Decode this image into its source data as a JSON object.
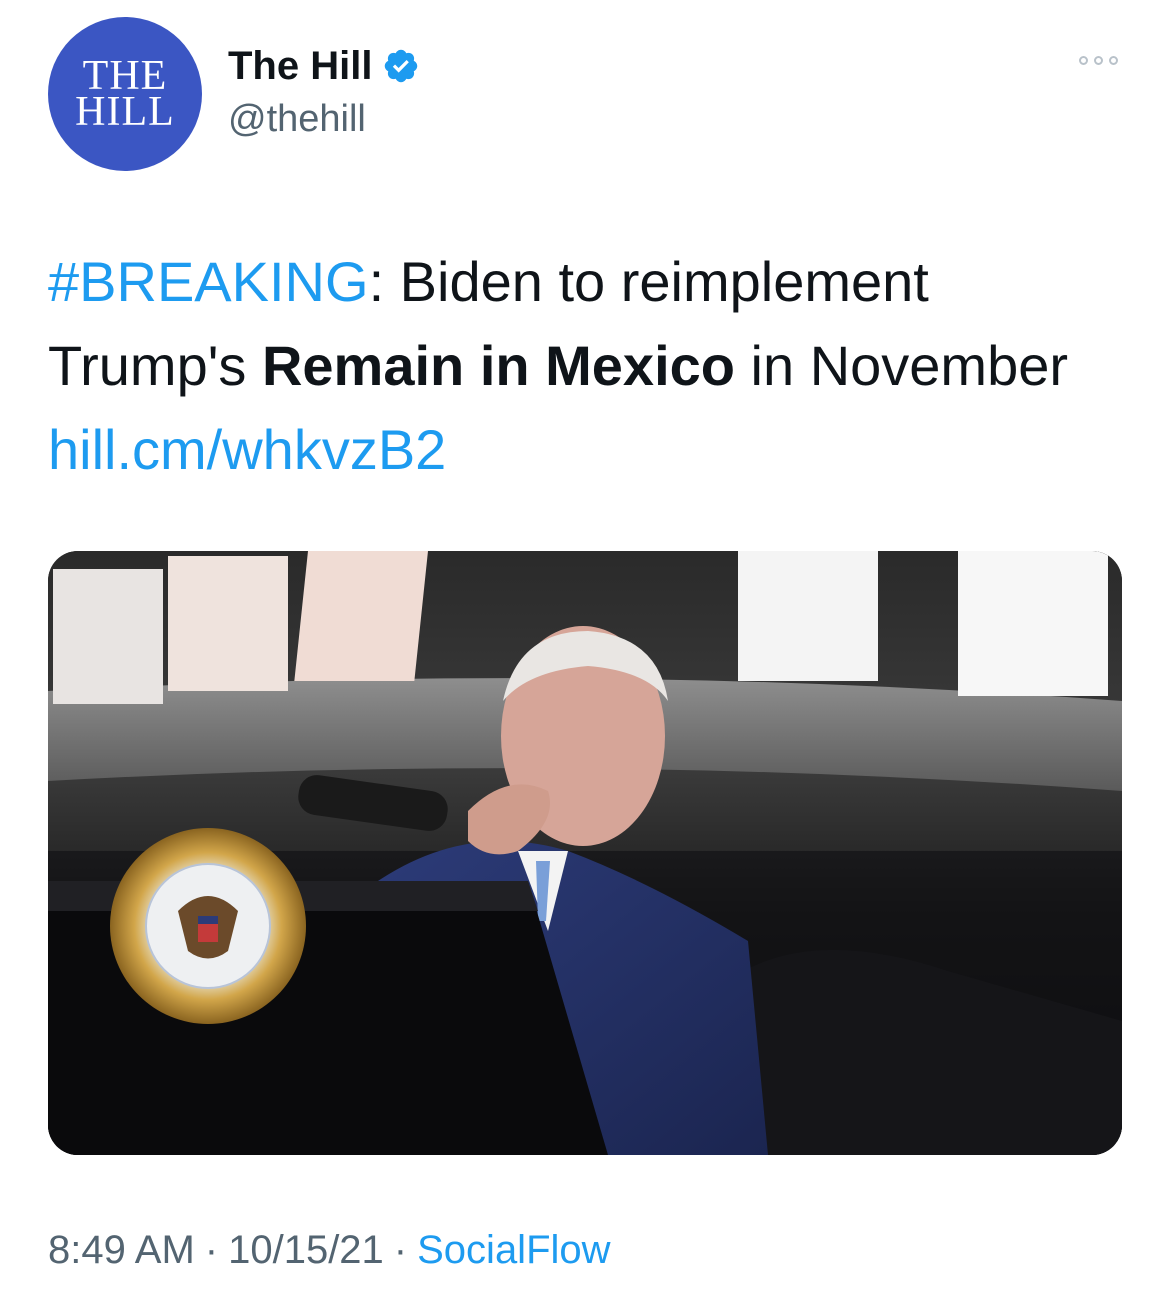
{
  "author": {
    "avatar_line1": "THE",
    "avatar_line2": "HILL",
    "display_name": "The Hill",
    "handle": "@thehill",
    "verified": true
  },
  "tweet": {
    "hashtag": "#BREAKING",
    "text_part1": ": Biden to reimplement Trump's ",
    "text_bold": "Remain in Mexico",
    "text_part2": " in November ",
    "link": "hill.cm/whkvzB2"
  },
  "meta": {
    "time": "8:49 AM",
    "date": "10/15/21",
    "source": "SocialFlow",
    "separator": "·"
  },
  "colors": {
    "link": "#1d9bf0",
    "avatar_bg": "#3b56c3",
    "muted": "#536471"
  }
}
